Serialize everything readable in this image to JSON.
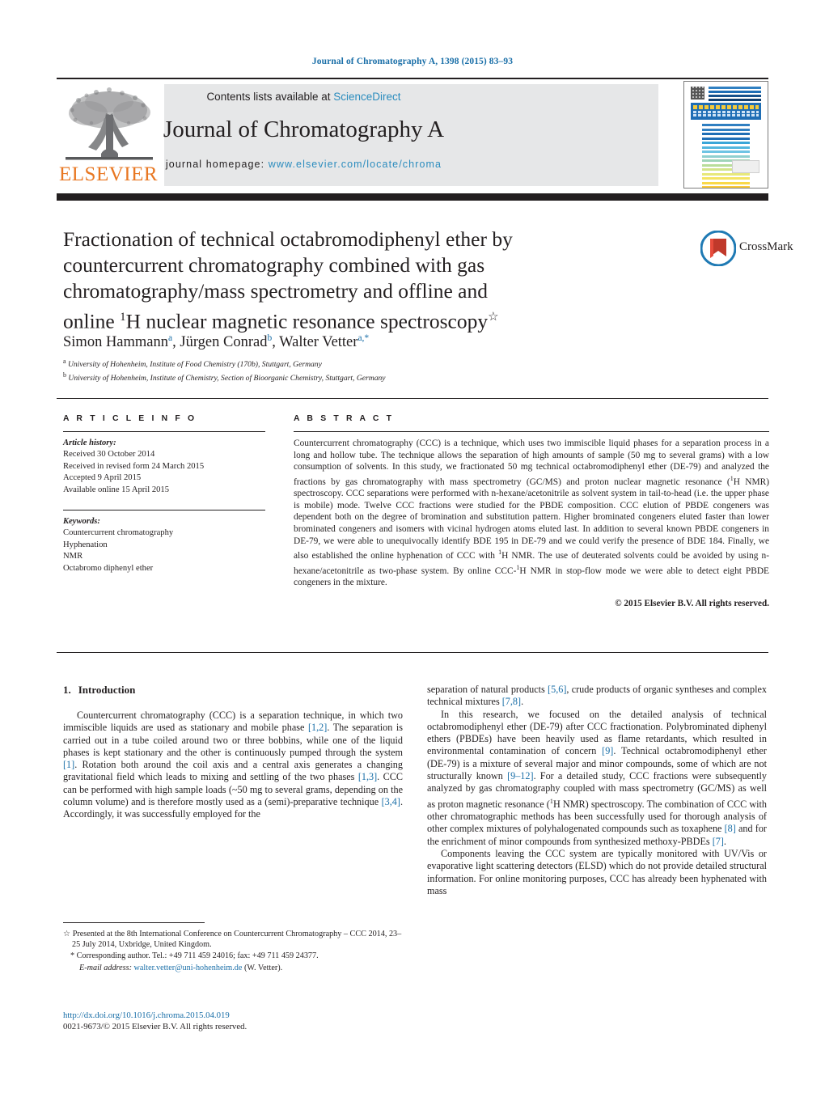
{
  "running_head": "Journal of Chromatography A, 1398 (2015) 83–93",
  "masthead": {
    "contents_prefix": "Contents lists available at ",
    "contents_link": "ScienceDirect",
    "journal_title": "Journal of Chromatography A",
    "homepage_prefix": "journal homepage: ",
    "homepage_url": "www.elsevier.com/locate/chroma",
    "publisher_name": "ELSEVIER",
    "publisher_color": "#E87722",
    "link_color": "#2b8cbe",
    "cover_stripe_colors": [
      "#2f7fc1",
      "#2f7fc1",
      "#1f6eb5",
      "#1f6eb5",
      "#3aa6d8",
      "#53b6de",
      "#6ec4e4",
      "#8fd0cf",
      "#9fd4b8",
      "#b8dd9a",
      "#d2e489",
      "#e7e87a",
      "#f4e463",
      "#f9d84a",
      "#fbc93a",
      "#f9b231",
      "#f59a2c",
      "#f0822a",
      "#e96a28",
      "#e25327",
      "#dc3d26",
      "#d93425"
    ]
  },
  "article": {
    "title_line1": "Fractionation of technical octabromodiphenyl ether by",
    "title_line2": "countercurrent chromatography combined with gas",
    "title_line3": "chromatography/mass spectrometry and offline and",
    "title_line4_pre": "online ",
    "title_line4_sup": "1",
    "title_line4_post": "H nuclear magnetic resonance spectroscopy",
    "title_footnote_mark": "☆",
    "crossmark_label": "CrossMark",
    "authors": [
      {
        "name": "Simon Hammann",
        "sup": "a",
        "sep": ", "
      },
      {
        "name": "Jürgen Conrad",
        "sup": "b",
        "sep": ", "
      },
      {
        "name": "Walter Vetter",
        "sup": "a,*",
        "sep": ""
      }
    ],
    "affiliations": [
      {
        "mark": "a",
        "text": "University of Hohenheim, Institute of Food Chemistry (170b), Stuttgart, Germany"
      },
      {
        "mark": "b",
        "text": "University of Hohenheim, Institute of Chemistry, Section of Bioorganic Chemistry, Stuttgart, Germany"
      }
    ]
  },
  "article_info": {
    "heading": "A R T I C L E   I N F O",
    "history_label": "Article history:",
    "history": [
      "Received 30 October 2014",
      "Received in revised form 24 March 2015",
      "Accepted 9 April 2015",
      "Available online 15 April 2015"
    ],
    "keywords_label": "Keywords:",
    "keywords": [
      "Countercurrent chromatography",
      "Hyphenation",
      "NMR",
      "Octabromo diphenyl ether"
    ]
  },
  "abstract": {
    "heading": "A B S T R A C T",
    "part1": "Countercurrent chromatography (CCC) is a technique, which uses two immiscible liquid phases for a separation process in a long and hollow tube. The technique allows the separation of high amounts of sample (50 mg to several grams) with a low consumption of solvents. In this study, we fractionated 50 mg technical octabromodiphenyl ether (DE-79) and analyzed the fractions by gas chromatography with mass spectrometry (GC/MS) and proton nuclear magnetic resonance (",
    "sup1": "1",
    "part2": "H NMR) spectroscopy. CCC separations were performed with n-hexane/acetonitrile as solvent system in tail-to-head (i.e. the upper phase is mobile) mode. Twelve CCC fractions were studied for the PBDE composition. CCC elution of PBDE congeners was dependent both on the degree of bromination and substitution pattern. Higher brominated congeners eluted faster than lower brominated congeners and isomers with vicinal hydrogen atoms eluted last. In addition to several known PBDE congeners in DE-79, we were able to unequivocally identify BDE 195 in DE-79 and we could verify the presence of BDE 184. Finally, we also established the online hyphenation of CCC with ",
    "sup2": "1",
    "part3": "H NMR. The use of deuterated solvents could be avoided by using n-hexane/acetonitrile as two-phase system. By online CCC-",
    "sup3": "1",
    "part4": "H NMR in stop-flow mode we were able to detect eight PBDE congeners in the mixture.",
    "copyright": "© 2015 Elsevier B.V. All rights reserved."
  },
  "introduction": {
    "section_number": "1.",
    "section_title": "Introduction",
    "left_p1_a": "Countercurrent chromatography (CCC) is a separation technique, in which two immiscible liquids are used as stationary and mobile phase ",
    "left_p1_ref1": "[1,2]",
    "left_p1_b": ". The separation is carried out in a tube coiled around two or three bobbins, while one of the liquid phases is kept stationary and the other is continuously pumped through the system ",
    "left_p1_ref2": "[1]",
    "left_p1_c": ". Rotation both around the coil axis and a central axis generates a changing gravitational field which leads to mixing and settling of the two phases ",
    "left_p1_ref3": "[1,3]",
    "left_p1_d": ". CCC can be performed with high sample loads (~50 mg to several grams, depending on the column volume) and is therefore mostly used as a (semi)-preparative technique ",
    "left_p1_ref4": "[3,4]",
    "left_p1_e": ". Accordingly, it was successfully employed for the",
    "right_p1_a": "separation of natural products ",
    "right_p1_ref1": "[5,6]",
    "right_p1_b": ", crude products of organic syntheses and complex technical mixtures ",
    "right_p1_ref2": "[7,8]",
    "right_p1_c": ".",
    "right_p2_a": "In this research, we focused on the detailed analysis of technical octabromodiphenyl ether (DE-79) after CCC fractionation. Polybrominated diphenyl ethers (PBDEs) have been heavily used as flame retardants, which resulted in environmental contamination of concern ",
    "right_p2_ref1": "[9]",
    "right_p2_b": ". Technical octabromodiphenyl ether (DE-79) is a mixture of several major and minor compounds, some of which are not structurally known ",
    "right_p2_ref2": "[9–12]",
    "right_p2_c": ". For a detailed study, CCC fractions were subsequently analyzed by gas chromatography coupled with mass spectrometry (GC/MS) as well as proton magnetic resonance (",
    "right_p2_sup": "1",
    "right_p2_d": "H NMR) spectroscopy. The combination of CCC with other chromatographic methods has been successfully used for thorough analysis of other complex mixtures of polyhalogenated compounds such as toxaphene ",
    "right_p2_ref3": "[8]",
    "right_p2_e": " and for the enrichment of minor compounds from synthesized methoxy-PBDEs ",
    "right_p2_ref4": "[7]",
    "right_p2_f": ".",
    "right_p3": "Components leaving the CCC system are typically monitored with UV/Vis or evaporative light scattering detectors (ELSD) which do not provide detailed structural information. For online monitoring purposes, CCC has already been hyphenated with mass"
  },
  "footnotes": {
    "star_mark": "☆",
    "star_text": "Presented at the 8th International Conference on Countercurrent Chromatography – CCC 2014, 23–25 July 2014, Uxbridge, United Kingdom.",
    "corr_mark": "*",
    "corr_text": "Corresponding author. Tel.: +49 711 459 24016; fax: +49 711 459 24377.",
    "email_label": "E-mail address:",
    "email": "walter.vetter@uni-hohenheim.de",
    "email_suffix": "(W. Vetter)."
  },
  "doi_block": {
    "doi_url": "http://dx.doi.org/10.1016/j.chroma.2015.04.019",
    "issn_line": "0021-9673/© 2015 Elsevier B.V. All rights reserved."
  }
}
